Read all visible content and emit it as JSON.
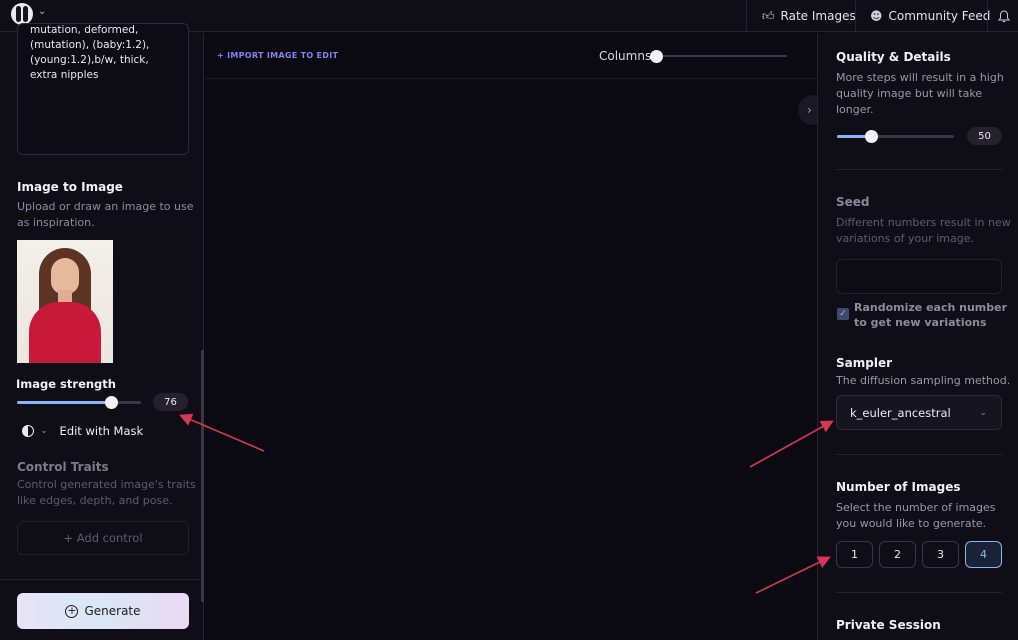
{
  "topbar": {
    "rate_images_label": "Rate Images",
    "community_feed_label": "Community Feed",
    "rate_icon": "thumbs-up-icon",
    "community_icon": "users-icon",
    "bell_icon": "bell-icon"
  },
  "left": {
    "prompt_text": "mutation, deformed, (mutation), (baby:1.2), (young:1.2),b/w, thick, extra nipples",
    "image_to_image": {
      "title": "Image to Image",
      "description": "Upload or draw an image to use as inspiration."
    },
    "image_strength": {
      "label": "Image strength",
      "value": "76",
      "fraction": 0.76
    },
    "edit_with_mask_label": "Edit with Mask",
    "control_traits": {
      "title": "Control Traits",
      "description": "Control generated image's traits like edges, depth, and pose.",
      "add_control_label": "+ Add control"
    },
    "generate_label": "Generate"
  },
  "center": {
    "import_label": "+ IMPORT IMAGE TO EDIT",
    "columns_label": "Columns",
    "columns_fraction": 0.0
  },
  "right": {
    "quality": {
      "title": "Quality & Details",
      "description": "More steps will result in a high quality image but will take longer.",
      "value": "50",
      "fraction": 0.29
    },
    "seed": {
      "title": "Seed",
      "description": "Different numbers result in new variations of your image.",
      "input_value": "",
      "randomize_label": "Randomize each number to get new variations",
      "randomize_checked": true
    },
    "sampler": {
      "title": "Sampler",
      "description": "The diffusion sampling method.",
      "selected": "k_euler_ancestral"
    },
    "number_of_images": {
      "title": "Number of Images",
      "description": "Select the number of images you would like to generate.",
      "options": [
        "1",
        "2",
        "3",
        "4"
      ],
      "selected": "4"
    },
    "private_session": {
      "title": "Private Session"
    }
  },
  "colors": {
    "accent_blue": "#8ab4f8",
    "annotation_arrow": "#d6355a",
    "import_link": "#8c7ff2"
  }
}
